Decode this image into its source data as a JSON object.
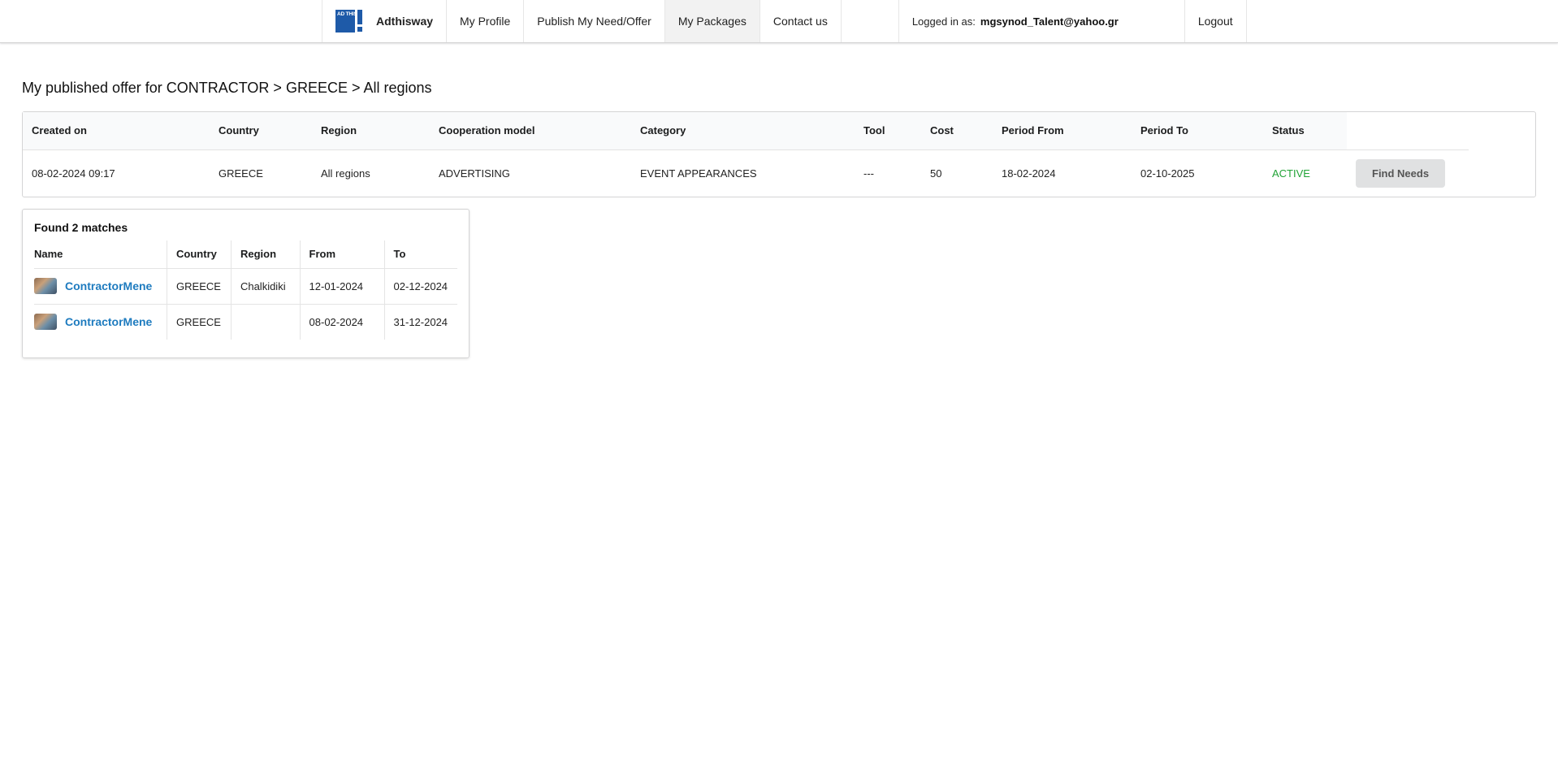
{
  "nav": {
    "brand": "Adthisway",
    "logo_text": "AD THIS WAY",
    "logo_color": "#1e5aa8",
    "items": [
      {
        "label": "My Profile",
        "active": false
      },
      {
        "label": "Publish My Need/Offer",
        "active": false
      },
      {
        "label": "My Packages",
        "active": true
      },
      {
        "label": "Contact us",
        "active": false
      }
    ],
    "logged_in_label": "Logged in as:",
    "logged_in_user": "mgsynod_Talent@yahoo.gr",
    "logout": "Logout"
  },
  "page": {
    "title": "My published offer for CONTRACTOR > GREECE > All regions"
  },
  "offer": {
    "columns": [
      "Created on",
      "Country",
      "Region",
      "Cooperation model",
      "Category",
      "Tool",
      "Cost",
      "Period From",
      "Period To",
      "Status"
    ],
    "row": {
      "created_on": "08-02-2024 09:17",
      "country": "GREECE",
      "region": "All regions",
      "cooperation_model": "ADVERTISING",
      "category": "EVENT APPEARANCES",
      "tool": "---",
      "cost": "50",
      "period_from": "18-02-2024",
      "period_to": "02-10-2025",
      "status": "ACTIVE",
      "status_color": "#21a336"
    },
    "action_button": "Find Needs"
  },
  "matches": {
    "title": "Found 2 matches",
    "columns": [
      "Name",
      "Country",
      "Region",
      "From",
      "To"
    ],
    "rows": [
      {
        "name": "ContractorMene",
        "country": "GREECE",
        "region": "Chalkidiki",
        "from": "12-01-2024",
        "to": "02-12-2024"
      },
      {
        "name": "ContractorMene",
        "country": "GREECE",
        "region": "",
        "from": "08-02-2024",
        "to": "31-12-2024"
      }
    ],
    "link_color": "#1e7bbf"
  }
}
